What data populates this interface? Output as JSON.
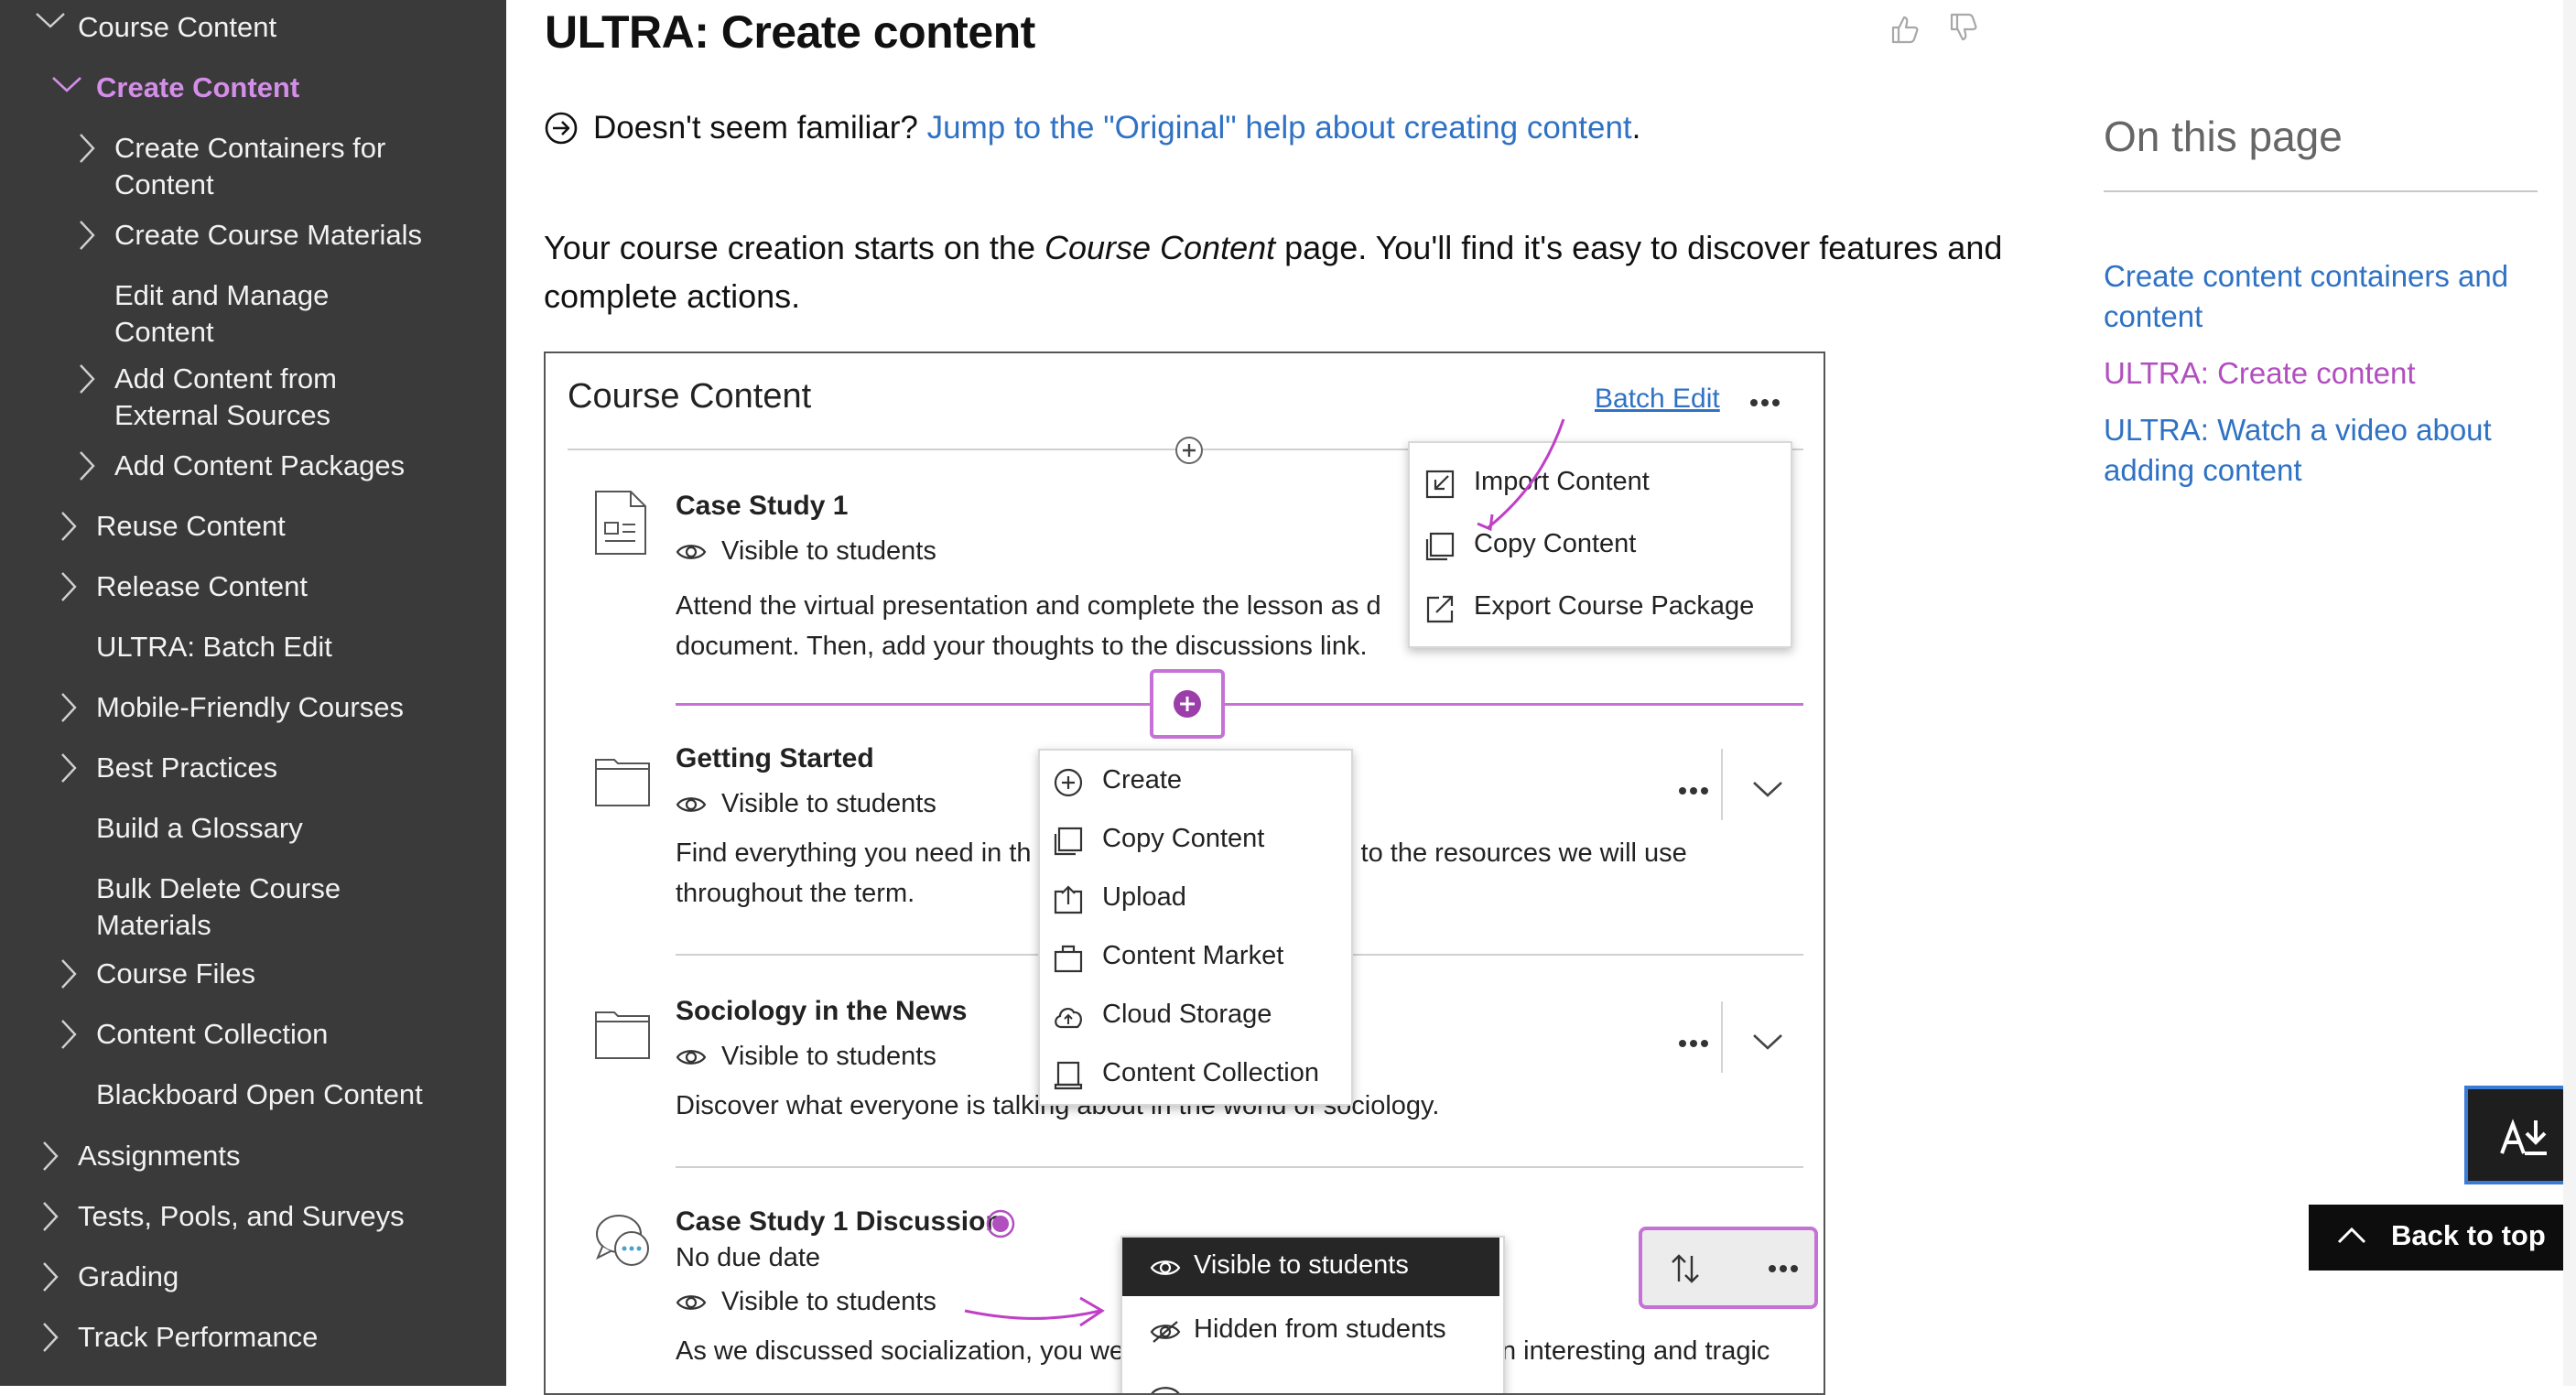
{
  "sidebar": {
    "items": [
      {
        "label": "Course Content",
        "expanded": true
      },
      {
        "label": "Create Content",
        "expanded": true,
        "active": true
      },
      {
        "label": "Create Containers for",
        "label2": "Content"
      },
      {
        "label": "Create Course Materials"
      },
      {
        "label": "Edit and Manage",
        "label2": "Content"
      },
      {
        "label": "Add Content from",
        "label2": "External Sources"
      },
      {
        "label": "Add Content Packages"
      },
      {
        "label": "Reuse Content"
      },
      {
        "label": "Release Content"
      },
      {
        "label": "ULTRA: Batch Edit"
      },
      {
        "label": "Mobile-Friendly Courses"
      },
      {
        "label": "Best Practices"
      },
      {
        "label": "Build a Glossary"
      },
      {
        "label": "Bulk Delete Course",
        "label2": "Materials"
      },
      {
        "label": "Course Files"
      },
      {
        "label": "Content Collection"
      },
      {
        "label": "Blackboard Open Content"
      },
      {
        "label": "Assignments"
      },
      {
        "label": "Tests, Pools, and Surveys"
      },
      {
        "label": "Grading"
      },
      {
        "label": "Track Performance"
      }
    ]
  },
  "main": {
    "title": "ULTRA: Create content",
    "familiar_prefix": "Doesn't seem familiar? ",
    "familiar_link": "Jump to the \"Original\" help about creating content",
    "familiar_suffix": ".",
    "intro_part1": "Your course creation starts on the ",
    "intro_em": "Course Content",
    "intro_part2": " page. You'll find it's easy to discover features and",
    "intro_line2": "complete actions."
  },
  "screenshot": {
    "header_title": "Course Content",
    "batch_edit": "Batch Edit",
    "items": [
      {
        "title": "Case Study 1",
        "visibility": "Visible to students",
        "desc1": "Attend the virtual presentation and complete the lesson as d",
        "desc2": "document. Then, add your thoughts to the discussions link."
      },
      {
        "title": "Getting Started",
        "visibility": "Visible to students",
        "desc1a": "Find everything you need in th",
        "desc1b": "s to the resources we will use",
        "desc2": "throughout the term."
      },
      {
        "title": "Sociology in the News",
        "visibility": "Visible to students",
        "desc1": "Discover what everyone is talking about in the world of sociology."
      },
      {
        "title": "Case Study 1 Discussion",
        "due": "No due date",
        "visibility": "Visible to students",
        "desc1a": "As we discussed socialization, you we",
        "desc1b": "n interesting and tragic"
      }
    ],
    "more_menu": [
      "Import Content",
      "Copy Content",
      "Export Course Package"
    ],
    "add_menu": [
      "Create",
      "Copy Content",
      "Upload",
      "Content Market",
      "Cloud Storage",
      "Content Collection"
    ],
    "visibility_menu": [
      "Visible to students",
      "Hidden from students"
    ]
  },
  "on_this_page": {
    "heading": "On this page",
    "links": [
      {
        "line1": "Create content containers and",
        "line2": "content",
        "active": false
      },
      {
        "line1": "ULTRA: Create content",
        "active": true
      },
      {
        "line1": "ULTRA: Watch a video about",
        "line2": "adding content",
        "active": false
      }
    ]
  },
  "back_to_top": "Back to top",
  "colors": {
    "accent": "#b24fbf",
    "link": "#2f72c4",
    "sidebar_bg": "#3a3a3a",
    "highlight": "#d48ee8"
  }
}
